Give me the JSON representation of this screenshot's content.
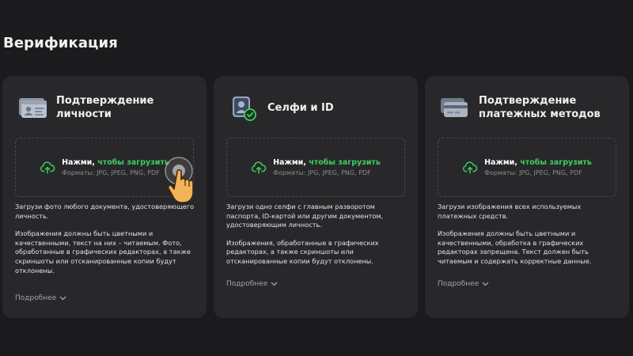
{
  "page": {
    "title": "Верификация"
  },
  "colors": {
    "background": "#1b1b1d",
    "card": "#28282b",
    "accent": "#3ccf5a"
  },
  "cards": [
    {
      "icon": "id-card-icon",
      "title": "Подтверждение личности",
      "upload": {
        "prefix": "Нажми, ",
        "link": "чтобы загрузить",
        "formats": "Форматы: JPG, JPEG, PNG, PDF"
      },
      "desc1": "Загрузи фото любого документа, удостоверяющего личность.",
      "desc2": "Изображения должны быть цветными и качественными, текст на них – читаемым. Фото, обработанные в графических редакторах, а также скриншоты или отсканированные копии будут отклонены.",
      "more": "Подробнее"
    },
    {
      "icon": "selfie-id-icon",
      "title": "Селфи и ID",
      "upload": {
        "prefix": "Нажми, ",
        "link": "чтобы загрузить",
        "formats": "Форматы: JPG, JPEG, PNG, PDF"
      },
      "desc1": "Загрузи одно селфи с главным разворотом паспорта, ID-картой или другим документом, удостоверяющим личность.",
      "desc2": "Изображения, обработанные в графических редакторах, а также скриншоты или отсканированные копии будут отклонены.",
      "more": "Подробнее"
    },
    {
      "icon": "payment-cards-icon",
      "title": "Подтверждение\nплатежных методов",
      "upload": {
        "prefix": "Нажми, ",
        "link": "чтобы загрузить",
        "formats": "Форматы: JPG, JPEG, PNG, PDF"
      },
      "desc1": "Загрузи изображения всех используемых платежных средств.",
      "desc2": "Изображения должны быть цветными и качественными, обработка в графических редакторах запрещена. Текст должен быть читаемым и содержать корректные данные.",
      "more": "Подробнее"
    }
  ]
}
